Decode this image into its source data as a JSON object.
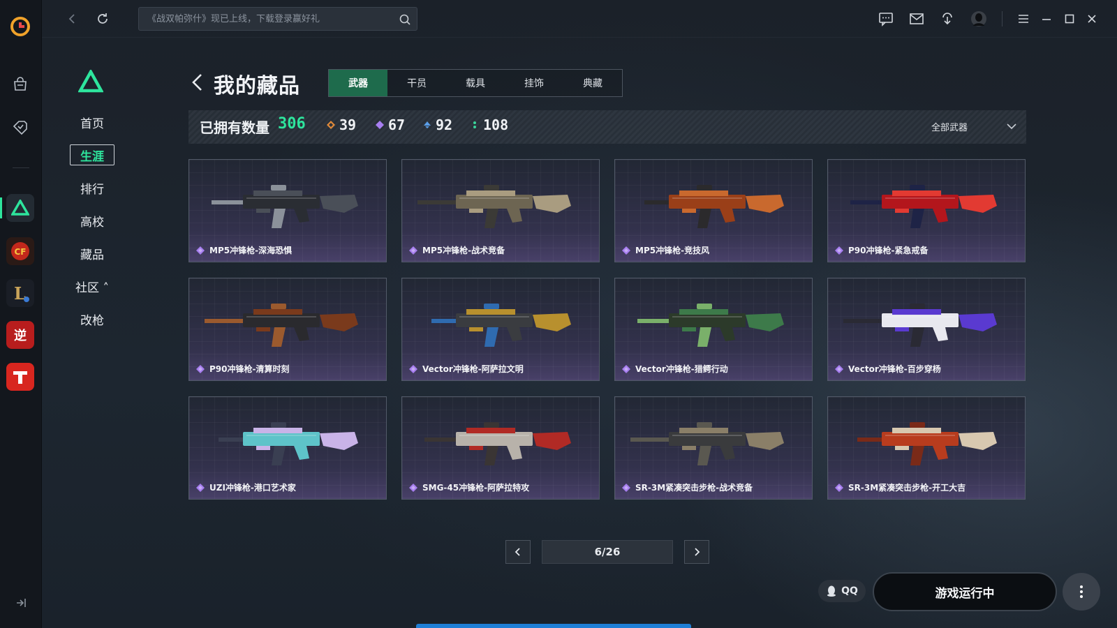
{
  "search": {
    "placeholder": "《战双帕弥什》现已上线，下载登录赢好礼"
  },
  "sidenav": {
    "items": [
      {
        "label": "首页"
      },
      {
        "label": "生涯",
        "active": true
      },
      {
        "label": "排行"
      },
      {
        "label": "高校"
      },
      {
        "label": "藏品"
      },
      {
        "label": "社区 ˄"
      },
      {
        "label": "改枪"
      }
    ]
  },
  "header": {
    "title": "我的藏品"
  },
  "tabs": [
    {
      "label": "武器",
      "active": true
    },
    {
      "label": "干员"
    },
    {
      "label": "载具"
    },
    {
      "label": "挂饰"
    },
    {
      "label": "典藏"
    }
  ],
  "stats": {
    "owned_label": "已拥有数量",
    "total": "306",
    "rarities": [
      {
        "value": "39",
        "color": "#e08a3a",
        "icon": "diamond-orange-icon"
      },
      {
        "value": "67",
        "color": "#a77ef0",
        "icon": "diamond-purple-icon"
      },
      {
        "value": "92",
        "color": "#5a9ee8",
        "icon": "diamond-blue-icon"
      },
      {
        "value": "108",
        "color": "#3ad39a",
        "icon": "dots-green-icon"
      }
    ],
    "filter": "全部武器"
  },
  "items": [
    {
      "name": "MP5冲锋枪-深海恐惧",
      "palette": [
        "#2a2d33",
        "#4a4f58",
        "#8b919a"
      ]
    },
    {
      "name": "MP5冲锋枪-战术竞备",
      "palette": [
        "#6d6552",
        "#a99c80",
        "#3b3a36"
      ]
    },
    {
      "name": "MP5冲锋枪-竞技风",
      "palette": [
        "#9a3f18",
        "#c9692e",
        "#2b2a2c"
      ]
    },
    {
      "name": "P90冲锋枪-紧急戒备",
      "palette": [
        "#b3161c",
        "#e23a32",
        "#1e2346"
      ]
    },
    {
      "name": "P90冲锋枪-清算时刻",
      "palette": [
        "#2a2a2e",
        "#7a3a1c",
        "#9b5a2e"
      ]
    },
    {
      "name": "Vector冲锋枪-阿萨拉文明",
      "palette": [
        "#3a3c40",
        "#b8902e",
        "#2f6bb0"
      ]
    },
    {
      "name": "Vector冲锋枪-猎鳄行动",
      "palette": [
        "#2c3a2a",
        "#3d7a4a",
        "#7ab06a"
      ]
    },
    {
      "name": "Vector冲锋枪-百步穿杨",
      "palette": [
        "#e8e8ef",
        "#5a3ad0",
        "#2a2a34"
      ]
    },
    {
      "name": "UZI冲锋枪-港口艺术家",
      "palette": [
        "#5ec3c9",
        "#c9b3e8",
        "#3a3f52"
      ]
    },
    {
      "name": "SMG-45冲锋枪-阿萨拉特攻",
      "palette": [
        "#b8b2aa",
        "#b12a25",
        "#3a3534"
      ]
    },
    {
      "name": "SR-3M紧凑突击步枪-战术竞备",
      "palette": [
        "#3a3b3d",
        "#8a7f68",
        "#5a5850"
      ]
    },
    {
      "name": "SR-3M紧凑突击步枪-开工大吉",
      "palette": [
        "#b83c1e",
        "#d8c8b0",
        "#7a2a18"
      ]
    }
  ],
  "rarity_color": "#a77ef0",
  "pagination": {
    "page": "6/26"
  },
  "footer": {
    "qq_label": "QQ",
    "run_label": "游戏运行中"
  },
  "colors": {
    "accent": "#2ee59d",
    "tab_active": "#1e6b4c"
  }
}
